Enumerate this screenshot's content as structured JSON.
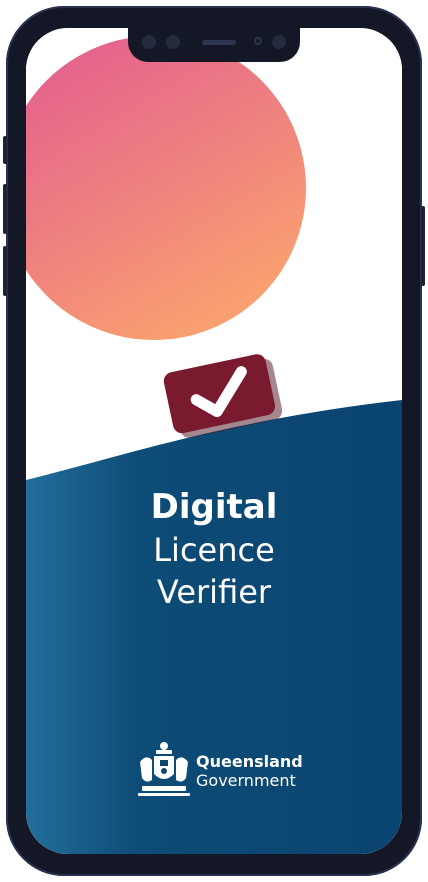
{
  "app": {
    "title_bold": "Digital",
    "title_line2": "Licence",
    "title_line3": "Verifier"
  },
  "logo": {
    "name": "Queensland",
    "sub": "Government",
    "crest_icon": "queensland-coat-of-arms-icon"
  },
  "icons": {
    "check": "checkmark-icon"
  },
  "colors": {
    "navy": "#0b4870",
    "navy_left": "#1f6a98",
    "maroon": "#7a1a2e",
    "gradient_top": "#e15f8e",
    "gradient_bottom": "#f79e72",
    "white": "#ffffff"
  }
}
